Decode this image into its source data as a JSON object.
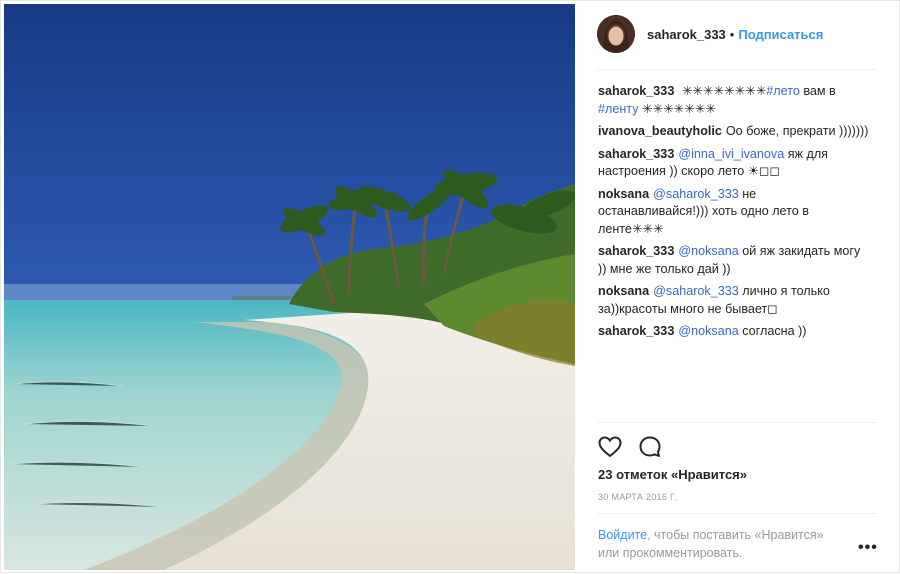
{
  "post": {
    "username": "saharok_333",
    "dot": "•",
    "follow_label": "Подписаться",
    "caption": {
      "user": "saharok_333",
      "prefix": "✳✳✳✳✳✳✳✳",
      "hashtag1": "#лето",
      "middle": " вам в",
      "hashtag2": "#ленту",
      "suffix": " ✳✳✳✳✳✳✳"
    },
    "comments": [
      {
        "user": "ivanova_beautyholic",
        "mention": "",
        "text": "Оо боже, прекрати )))))))"
      },
      {
        "user": "saharok_333",
        "mention": "@inna_ivi_ivanova",
        "text": " яж для настроения )) скоро лето ☀◻◻"
      },
      {
        "user": "noksana",
        "mention": "@saharok_333",
        "text": " не останавливайся!))) хоть одно лето в ленте✳✳✳"
      },
      {
        "user": "saharok_333",
        "mention": "@noksana",
        "text": " ой яж закидать могу )) мне же только дай ))"
      },
      {
        "user": "noksana",
        "mention": "@saharok_333",
        "text": " лично я только за))красоты много не бывает◻"
      },
      {
        "user": "saharok_333",
        "mention": "@noksana",
        "text": " согласна ))"
      }
    ],
    "likes": "23 отметок «Нравится»",
    "date": "30 МАРТА 2016 Г.",
    "login_link": "Войдите",
    "login_text": ", чтобы поставить «Нравится» или прокомментировать.",
    "more_label": "•••",
    "icons": {
      "like": "heart-icon",
      "comment": "comment-icon",
      "more": "more-options-icon"
    },
    "colors": {
      "accent": "#3897f0",
      "link": "#3a67c9",
      "muted": "#999999"
    }
  }
}
